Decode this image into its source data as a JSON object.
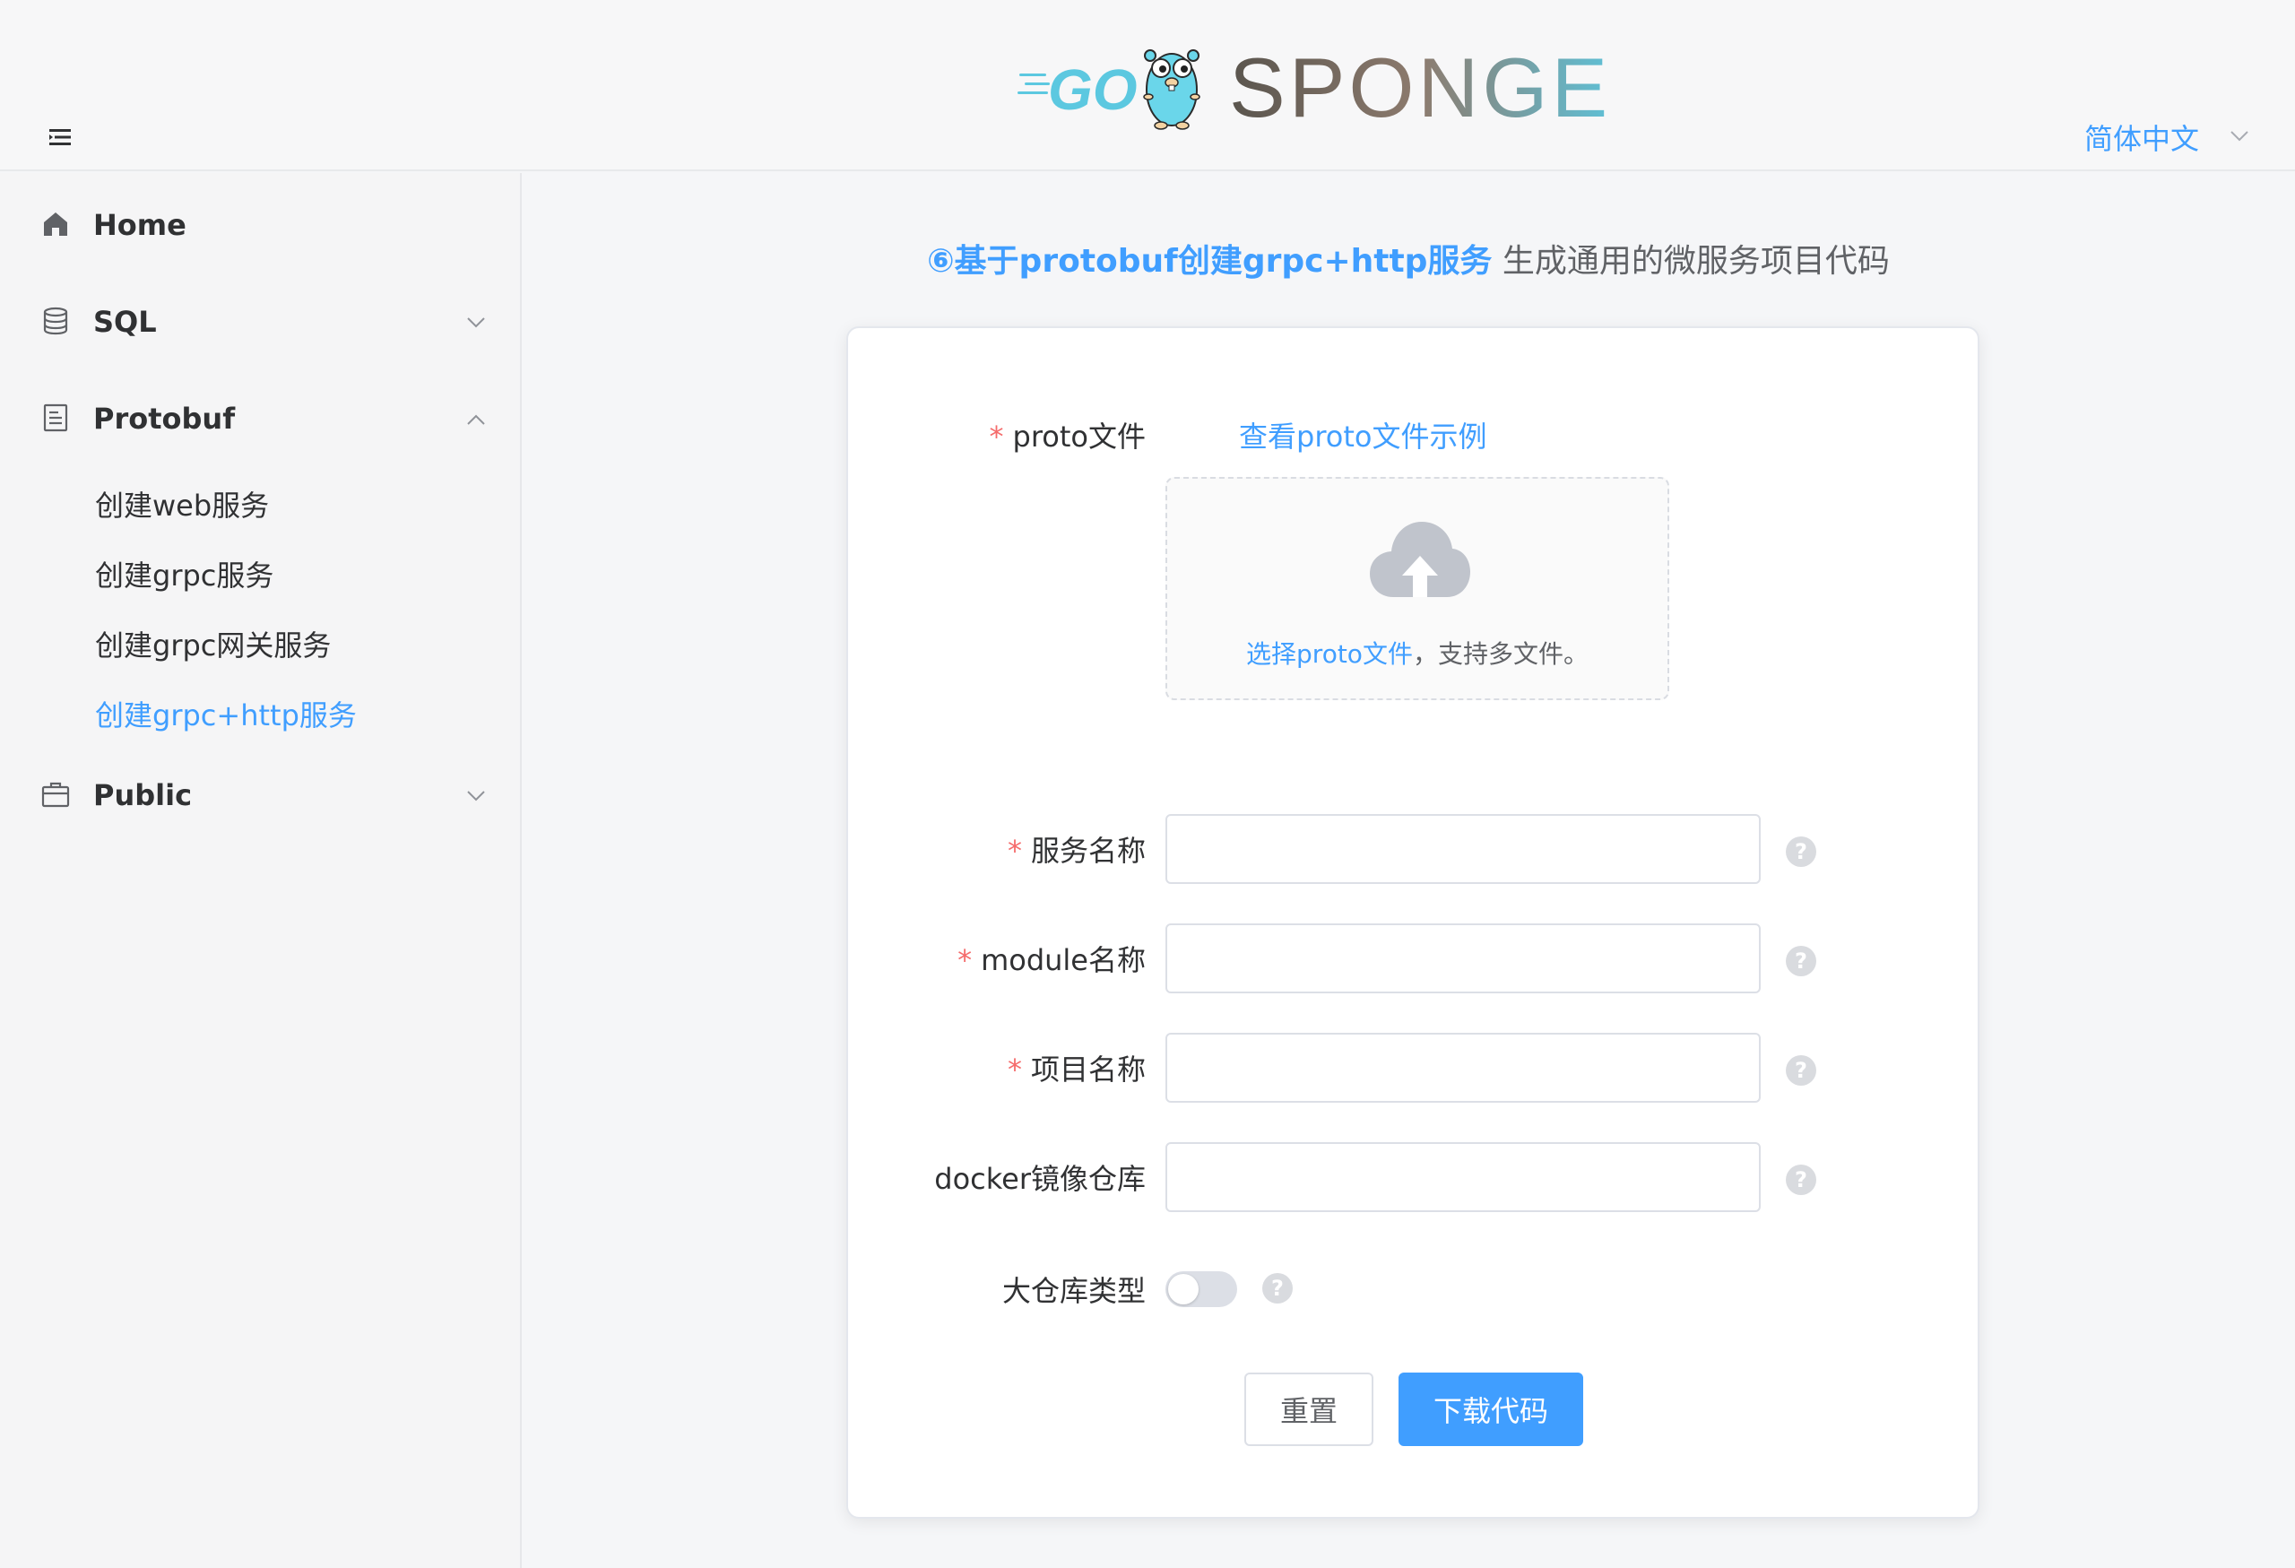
{
  "header": {
    "logo_text": "SPONGE",
    "logo_go_text": "GO",
    "language": "简体中文"
  },
  "sidebar": {
    "items": [
      {
        "label": "Home",
        "icon": "home-icon"
      },
      {
        "label": "SQL",
        "icon": "database-icon"
      },
      {
        "label": "Protobuf",
        "icon": "document-icon"
      },
      {
        "label": "Public",
        "icon": "briefcase-icon"
      }
    ],
    "protobuf_children": [
      {
        "label": "创建web服务"
      },
      {
        "label": "创建grpc服务"
      },
      {
        "label": "创建grpc网关服务"
      },
      {
        "label": "创建grpc+http服务"
      }
    ]
  },
  "main": {
    "title_strong": "⑥基于protobuf创建grpc+http服务",
    "title_rest": "生成通用的微服务项目代码",
    "form": {
      "proto_label": "proto文件",
      "proto_example_link": "查看proto文件示例",
      "upload_link_text": "选择proto文件",
      "upload_rest_text": "，支持多文件。",
      "service_name_label": "服务名称",
      "service_name_value": "",
      "module_name_label": "module名称",
      "module_name_value": "",
      "project_name_label": "项目名称",
      "project_name_value": "",
      "docker_label": "docker镜像仓库",
      "docker_value": "",
      "mono_repo_label": "大仓库类型",
      "required_mark": "*",
      "help_mark": "?",
      "reset_button": "重置",
      "download_button": "下载代码"
    }
  },
  "colors": {
    "primary": "#409eff",
    "required": "#f56c6c",
    "text": "#303133"
  }
}
